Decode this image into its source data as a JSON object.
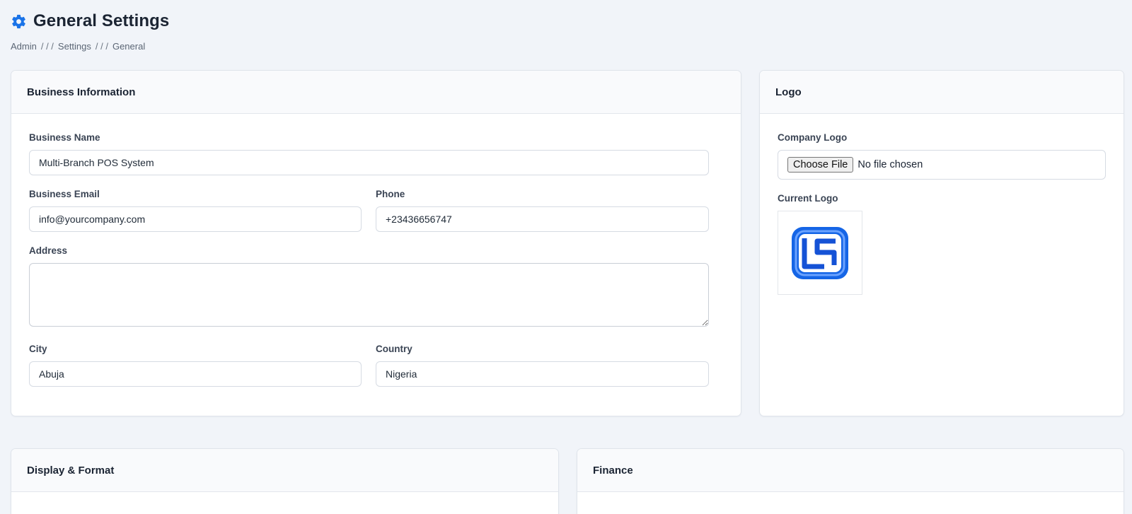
{
  "header": {
    "title": "General Settings",
    "breadcrumb": [
      "Admin",
      "Settings",
      "General"
    ],
    "separator": "/ / /"
  },
  "business": {
    "heading": "Business Information",
    "name_label": "Business Name",
    "name_value": "Multi-Branch POS System",
    "email_label": "Business Email",
    "email_value": "info@yourcompany.com",
    "phone_label": "Phone",
    "phone_value": "+23436656747",
    "address_label": "Address",
    "address_value": "",
    "city_label": "City",
    "city_value": "Abuja",
    "country_label": "Country",
    "country_value": "Nigeria"
  },
  "logo": {
    "heading": "Logo",
    "company_logo_label": "Company Logo",
    "choose_file_label": "Choose File",
    "no_file_text": "No file chosen",
    "current_logo_label": "Current Logo"
  },
  "sections": {
    "display_heading": "Display & Format",
    "finance_heading": "Finance"
  },
  "colors": {
    "accent": "#1a73e8",
    "background": "#f1f4f9",
    "logo_blue": "#1565e6"
  },
  "icons": {
    "title_icon": "gear-icon"
  }
}
